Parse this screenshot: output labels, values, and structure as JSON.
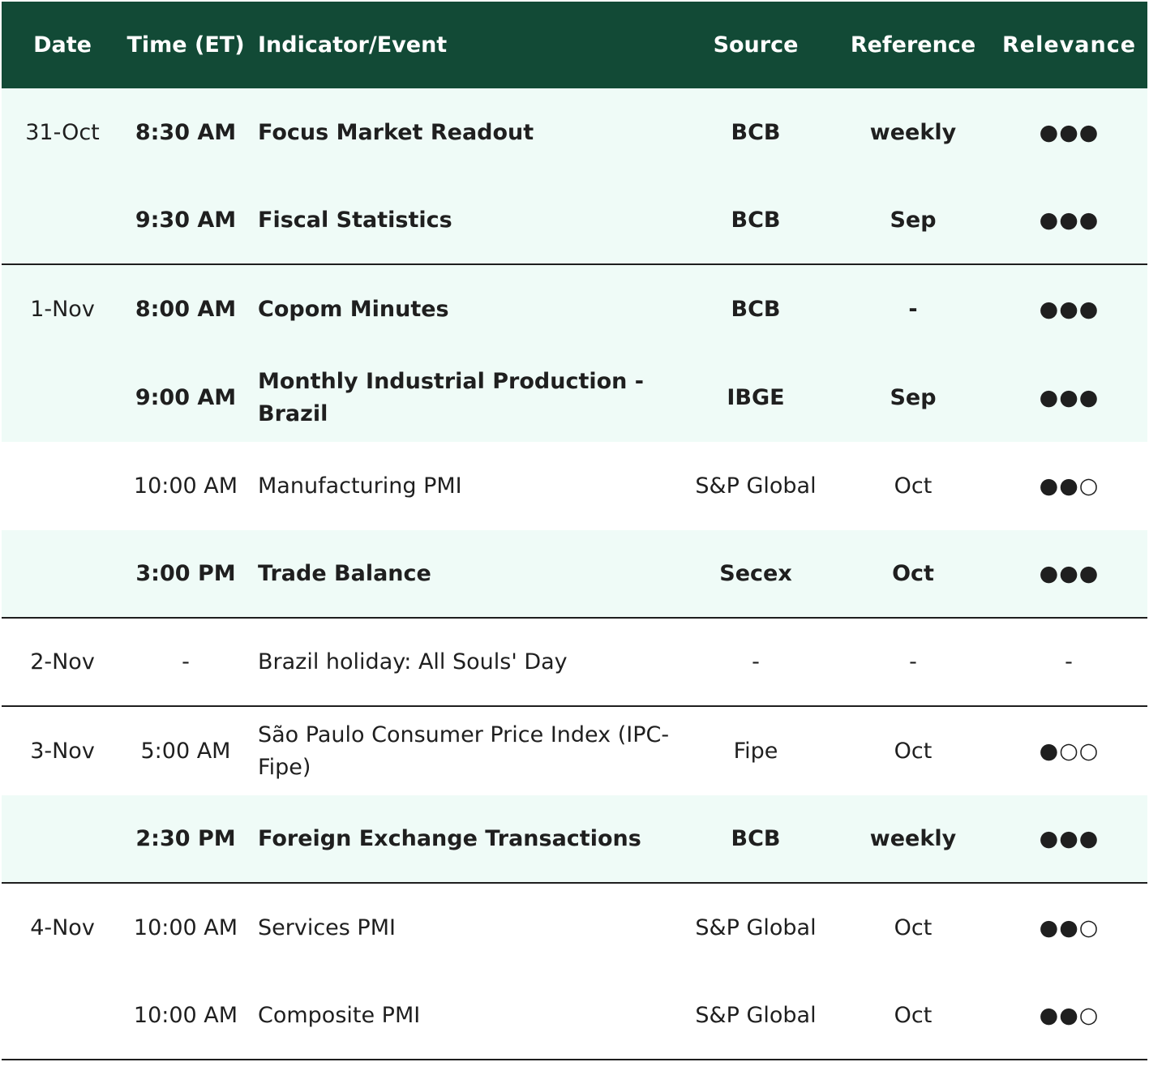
{
  "header": {
    "date": "Date",
    "time": "Time (ET)",
    "event": "Indicator/Event",
    "source": "Source",
    "reference": "Reference",
    "relevance": "Relevance"
  },
  "rows": [
    {
      "date": "31-Oct",
      "time": "8:30 AM",
      "event": "Focus Market Readout",
      "source": "BCB",
      "reference": "weekly",
      "relevance": "●●●"
    },
    {
      "date": "",
      "time": "9:30 AM",
      "event": "Fiscal Statistics",
      "source": "BCB",
      "reference": "Sep",
      "relevance": "●●●"
    },
    {
      "date": "1-Nov",
      "time": "8:00 AM",
      "event": "Copom Minutes",
      "source": "BCB",
      "reference": "-",
      "relevance": "●●●"
    },
    {
      "date": "",
      "time": "9:00 AM",
      "event": "Monthly Industrial Production - Brazil",
      "source": "IBGE",
      "reference": "Sep",
      "relevance": "●●●"
    },
    {
      "date": "",
      "time": "10:00 AM",
      "event": "Manufacturing PMI",
      "source": "S&P Global",
      "reference": "Oct",
      "relevance": "●●○"
    },
    {
      "date": "",
      "time": "3:00 PM",
      "event": "Trade Balance",
      "source": "Secex",
      "reference": "Oct",
      "relevance": "●●●"
    },
    {
      "date": "2-Nov",
      "time": "-",
      "event": "Brazil holiday: All Souls' Day",
      "source": "-",
      "reference": "-",
      "relevance": "-"
    },
    {
      "date": "3-Nov",
      "time": "5:00 AM",
      "event": "São Paulo Consumer Price Index (IPC-Fipe)",
      "source": "Fipe",
      "reference": "Oct",
      "relevance": "●○○"
    },
    {
      "date": "",
      "time": "2:30 PM",
      "event": "Foreign Exchange Transactions",
      "source": "BCB",
      "reference": "weekly",
      "relevance": "●●●"
    },
    {
      "date": "4-Nov",
      "time": "10:00 AM",
      "event": "Services PMI",
      "source": "S&P Global",
      "reference": "Oct",
      "relevance": "●●○"
    },
    {
      "date": "",
      "time": "10:00 AM",
      "event": "Composite PMI",
      "source": "S&P Global",
      "reference": "Oct",
      "relevance": "●●○"
    }
  ]
}
